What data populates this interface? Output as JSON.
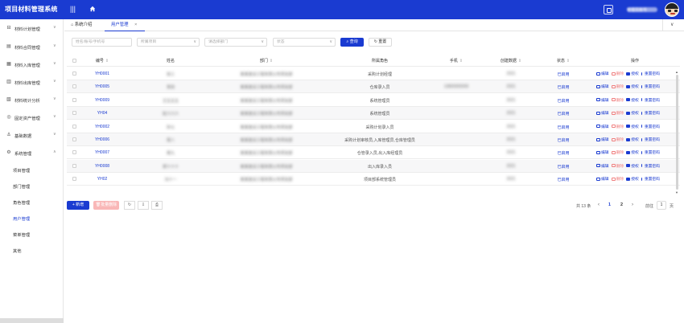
{
  "header": {
    "app_title": "项目材料管理系统",
    "menu_toggle_glyph": "|||",
    "user_name": "管理员账号"
  },
  "sidebar": {
    "items": [
      {
        "label": "材料计划管理",
        "icon": "⊟",
        "chevron": "∨"
      },
      {
        "label": "材料合同管理",
        "icon": "▤",
        "chevron": "∨"
      },
      {
        "label": "材料入库管理",
        "icon": "▦",
        "chevron": "∨"
      },
      {
        "label": "材料出库管理",
        "icon": "▥",
        "chevron": "∨"
      },
      {
        "label": "材料统计分析",
        "icon": "▧",
        "chevron": "∨"
      },
      {
        "label": "固定资产管理",
        "icon": "◎",
        "chevron": "∨"
      },
      {
        "label": "基础数据",
        "icon": "⚓",
        "chevron": "∨"
      },
      {
        "label": "系统管理",
        "icon": "⚙",
        "chevron": "∧"
      }
    ],
    "sub_items": [
      {
        "label": "项目管理"
      },
      {
        "label": "部门管理"
      },
      {
        "label": "角色管理"
      },
      {
        "label": "用户管理"
      },
      {
        "label": "菜单管理"
      },
      {
        "label": "其他"
      }
    ]
  },
  "tabs": {
    "home_label": "系统介绍",
    "active_label": "用户管理",
    "close_glyph": "×",
    "more_glyph": "∨"
  },
  "filters": {
    "keyword_placeholder": "姓名/账号/手机号",
    "project_placeholder": "所属项目",
    "dept_placeholder": "请选择部门",
    "status_placeholder": "状态",
    "search_label": "查询",
    "reset_label": "重置",
    "dd_glyph": "∨"
  },
  "table": {
    "columns": [
      {
        "label": "编号",
        "sort": "⇕"
      },
      {
        "label": "姓名",
        "sort": ""
      },
      {
        "label": "部门",
        "sort": "⇕"
      },
      {
        "label": "所属角色",
        "sort": ""
      },
      {
        "label": "手机",
        "sort": "⇕"
      },
      {
        "label": "创建数据",
        "sort": "⇕"
      },
      {
        "label": "状态",
        "sort": "⇕"
      },
      {
        "label": "操作",
        "sort": ""
      }
    ],
    "rows": [
      {
        "code": "YH0001",
        "name": "张三",
        "dept": "某某建设工程有限公司项目部",
        "role": "采购计划经理",
        "phone": "",
        "created": "2021",
        "status": "已启用"
      },
      {
        "code": "YH0005",
        "name": "李四",
        "dept": "某某建设工程有限公司项目部",
        "role": "仓库录入员",
        "phone": "13800000000",
        "created": "2021",
        "status": "已启用"
      },
      {
        "code": "YH0009",
        "name": "王五五五",
        "dept": "某某建设工程有限公司项目部",
        "role": "系统管理员",
        "phone": "",
        "created": "2021",
        "status": "已启用"
      },
      {
        "code": "YH04",
        "name": "赵六六六",
        "dept": "某某建设工程有限公司项目部",
        "role": "系统管理员",
        "phone": "",
        "created": "2021",
        "status": "已启用"
      },
      {
        "code": "YH0002",
        "name": "孙七",
        "dept": "某某建设工程有限公司项目部",
        "role": "采购计划录入员",
        "phone": "",
        "created": "2021",
        "status": "已启用"
      },
      {
        "code": "YH0006",
        "name": "周八",
        "dept": "某某建设工程有限公司项目部",
        "role": "采购计划审核员,入库管理员,仓库管理员",
        "phone": "",
        "created": "2021",
        "status": "已启用"
      },
      {
        "code": "YH0007",
        "name": "吴九",
        "dept": "某某建设工程有限公司项目部",
        "role": "仓管录入员,出入库经理员",
        "phone": "",
        "created": "2021",
        "status": "已启用"
      },
      {
        "code": "YH0008",
        "name": "郑十十十",
        "dept": "某某建设工程有限公司项目部",
        "role": "出入库录入员",
        "phone": "",
        "created": "2021",
        "status": "已启用"
      },
      {
        "code": "YH02",
        "name": "冯十一",
        "dept": "某某建设工程有限公司项目部",
        "role": "项目部系统管理员",
        "phone": "",
        "created": "2021",
        "status": "已启用"
      }
    ],
    "ops": {
      "edit": "编辑",
      "delete": "删除",
      "auth": "授权",
      "reset_pwd": "重置密码"
    }
  },
  "toolbar": {
    "add_label": "新增",
    "add_glyph": "+",
    "batch_delete_label": "批量删除",
    "refresh_glyph": "↻",
    "export_glyph": "⇩",
    "print_glyph": "⎙"
  },
  "pagination": {
    "total": "共 13 条",
    "pages": [
      "1",
      "2"
    ],
    "current": "1",
    "goto_label": "前往",
    "goto_value": "1",
    "unit": "页",
    "prev": "‹",
    "next": "›"
  },
  "colors": {
    "primary": "#1a3bd1",
    "danger_light": "#f9b7b7",
    "danger_text": "#f07f7f"
  }
}
